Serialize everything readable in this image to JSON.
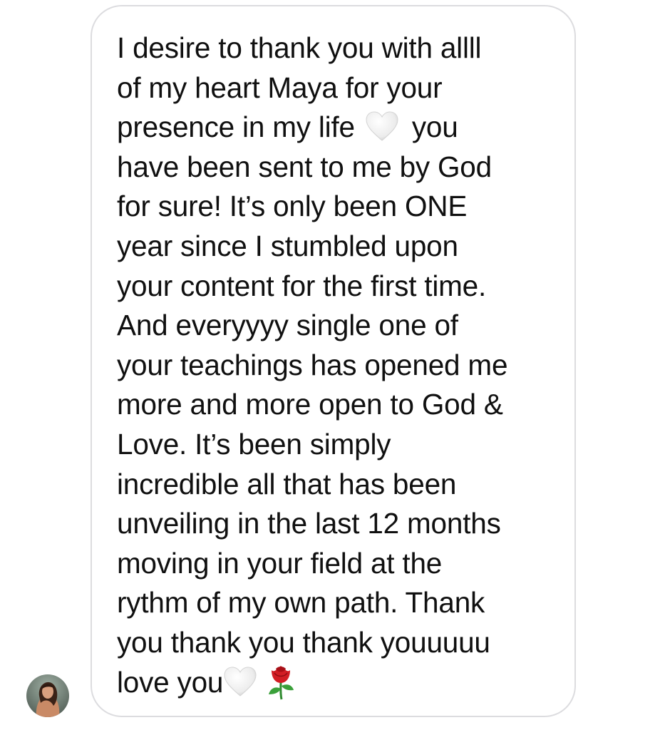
{
  "conversation": {
    "sender_avatar": "profile-photo",
    "message": {
      "lines": [
        "I desire to thank you with allll",
        "of my heart Maya for your",
        "presence in my life",
        "you",
        "have been sent to me by God",
        "for sure! It’s only been ONE",
        "year since I stumbled upon",
        "your content for the first time.",
        "And everyyyy single one of",
        "your teachings has opened me",
        "more and more open to God &",
        "Love. It’s been simply",
        "incredible all that has been",
        "unveiling in the last 12 months",
        "moving in your field at the",
        "rythm of my own path. Thank",
        "you thank you thank youuuuu",
        "love you"
      ],
      "emojis": [
        "white-heart-icon",
        "white-heart-icon",
        "red-rose-icon"
      ]
    }
  },
  "colors": {
    "background": "#ffffff",
    "bubble_border": "#dcdcdf",
    "text": "#101010"
  }
}
